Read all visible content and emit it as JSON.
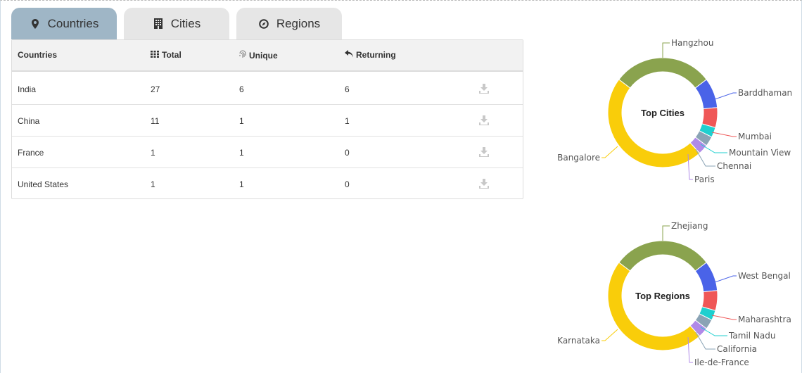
{
  "tabs": [
    {
      "label": "Countries",
      "icon": "map-marker-icon",
      "active": true
    },
    {
      "label": "Cities",
      "icon": "building-icon",
      "active": false
    },
    {
      "label": "Regions",
      "icon": "compass-icon",
      "active": false
    }
  ],
  "table": {
    "headers": {
      "country": "Countries",
      "total": "Total",
      "unique": "Unique",
      "returning": "Returning"
    },
    "rows": [
      {
        "country": "India",
        "total": "27",
        "unique": "6",
        "returning": "6"
      },
      {
        "country": "China",
        "total": "11",
        "unique": "1",
        "returning": "1"
      },
      {
        "country": "France",
        "total": "1",
        "unique": "1",
        "returning": "0"
      },
      {
        "country": "United States",
        "total": "1",
        "unique": "1",
        "returning": "0"
      }
    ]
  },
  "chart_data": [
    {
      "type": "pie",
      "title": "Top Cities",
      "categories": [
        "Hangzhou",
        "Barddhaman",
        "Mumbai",
        "Mountain View",
        "Chennai",
        "Paris",
        "Bangalore"
      ],
      "values": [
        10,
        3,
        2,
        1,
        1,
        1,
        16
      ],
      "colors": [
        "#8aa34e",
        "#4a63e8",
        "#ef5757",
        "#1fcfcf",
        "#8aa3b5",
        "#b08ae8",
        "#f9cd0a"
      ]
    },
    {
      "type": "pie",
      "title": "Top Regions",
      "categories": [
        "Zhejiang",
        "West Bengal",
        "Maharashtra",
        "Tamil Nadu",
        "California",
        "Ile-de-France",
        "Karnataka"
      ],
      "values": [
        10,
        3,
        2,
        1,
        1,
        1,
        16
      ],
      "colors": [
        "#8aa34e",
        "#4a63e8",
        "#ef5757",
        "#1fcfcf",
        "#8aa3b5",
        "#b08ae8",
        "#f9cd0a"
      ]
    }
  ]
}
